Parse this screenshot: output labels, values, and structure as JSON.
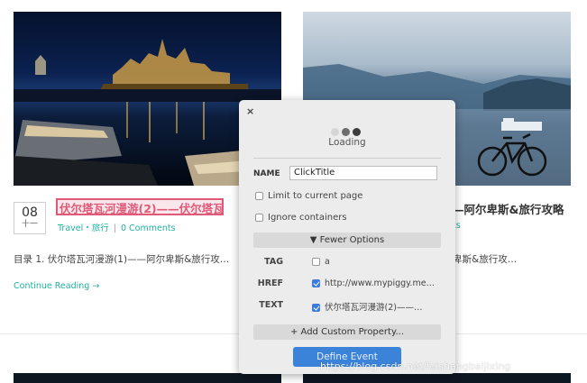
{
  "post1": {
    "date_day": "08",
    "date_month": "十一",
    "title": "伏尔塔瓦河漫游(2)——伏尔塔瓦",
    "category": "Travel・旅行",
    "separator": "|",
    "comments": "0 Comments",
    "excerpt": "目录 1. 伏尔塔瓦河漫游(1)——阿尔卑斯&旅行攻…",
    "continue": "Continue Reading →"
  },
  "post2": {
    "title": "—阿尔卑斯&旅行攻略",
    "comments": "ts",
    "excerpt": "卑斯&旅行攻…"
  },
  "dialog": {
    "close": "×",
    "loading": "Loading",
    "name_label": "NAME",
    "name_value": "ClickTitle",
    "limit_label": "Limit to current page",
    "ignore_label": "Ignore containers",
    "fewer_label": "▼ Fewer Options",
    "props": [
      {
        "key": "TAG",
        "value": "a",
        "checked": false
      },
      {
        "key": "HREF",
        "value": "http://www.mypiggy.me…",
        "checked": true
      },
      {
        "key": "TEXT",
        "value": "伏尔塔瓦河漫游(2)——…",
        "checked": true
      }
    ],
    "add_label": "+ Add Custom Property...",
    "define_label": "Define Event"
  },
  "watermark": "https://blog.csdn.net/feishangbaijixing",
  "colors": {
    "accent": "#21b29f",
    "highlight": "#e05a78",
    "primary_button": "#3b82d9"
  }
}
